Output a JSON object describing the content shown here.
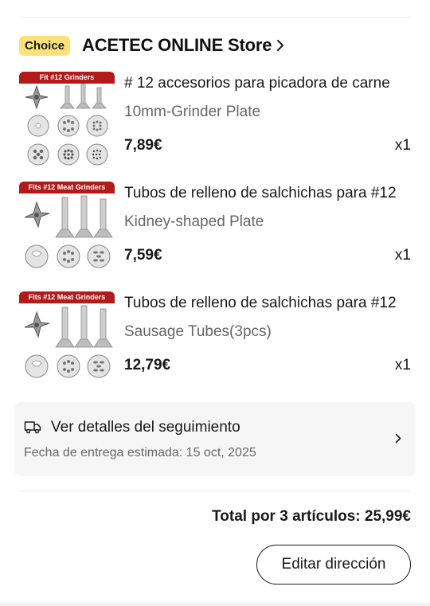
{
  "store": {
    "badge": "Choice",
    "name": "ACETEC ONLINE Store"
  },
  "items": [
    {
      "image_banner": "Fit #12 Grinders",
      "title": "# 12 accesorios para picadora de carne",
      "variant": "10mm-Grinder Plate",
      "price": "7,89€",
      "quantity": "x1"
    },
    {
      "image_banner": "Fits #12 Meat Grinders",
      "title": "Tubos de relleno de salchichas para #12",
      "variant": "Kidney-shaped Plate",
      "price": "7,59€",
      "quantity": "x1"
    },
    {
      "image_banner": "Fits #12 Meat Grinders",
      "title": "Tubos de relleno de salchichas para #12",
      "variant": "Sausage Tubes(3pcs)",
      "price": "12,79€",
      "quantity": "x1"
    }
  ],
  "tracking": {
    "title": "Ver detalles del seguimiento",
    "delivery_estimate": "Fecha de entrega estimada: 15 oct, 2025"
  },
  "summary": {
    "total": "Total por 3 artículos: 25,99€"
  },
  "actions": {
    "edit_address": "Editar dirección"
  },
  "icons": {
    "store_chevron": "chevron-right-icon",
    "tracking": "truck-icon",
    "tracking_chevron": "chevron-right-icon"
  },
  "colors": {
    "choice_badge": "#fbe17a",
    "banner_red": "#b31b1b",
    "card_bg": "#f6f6f6"
  }
}
